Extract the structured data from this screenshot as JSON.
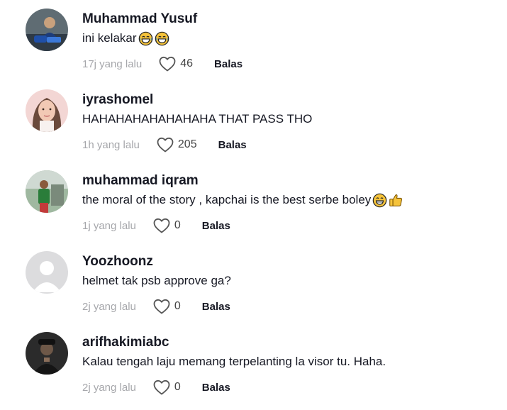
{
  "comments": [
    {
      "username": "Muhammad Yusuf",
      "text": "ini kelakar",
      "emojis": [
        "laughing-face-emoji",
        "laughing-face-emoji"
      ],
      "time": "17j yang lalu",
      "likes": "46",
      "reply": "Balas"
    },
    {
      "username": "iyrashomel",
      "text": "HAHAHAHAHAHAHAHA THAT PASS THO",
      "emojis": [],
      "time": "1h yang lalu",
      "likes": "205",
      "reply": "Balas"
    },
    {
      "username": "muhammad iqram",
      "text": "the moral of the story , kapchai is the best serbe boley ",
      "emojis": [
        "grinning-face-emoji",
        "thumbs-up-emoji"
      ],
      "time": "1j yang lalu",
      "likes": "0",
      "reply": "Balas"
    },
    {
      "username": "Yoozhoonz",
      "text": "helmet tak psb approve ga?",
      "emojis": [],
      "time": "2j yang lalu",
      "likes": "0",
      "reply": "Balas"
    },
    {
      "username": "arifhakimiabc",
      "text": "Kalau tengah laju memang terpelanting la visor tu. Haha.",
      "emojis": [],
      "time": "2j yang lalu",
      "likes": "0",
      "reply": "Balas"
    }
  ],
  "icons": {
    "like": "heart-outline-icon"
  },
  "colors": {
    "text": "#161823",
    "muted": "#a6a7ab",
    "emoji": "#f5c33b"
  }
}
